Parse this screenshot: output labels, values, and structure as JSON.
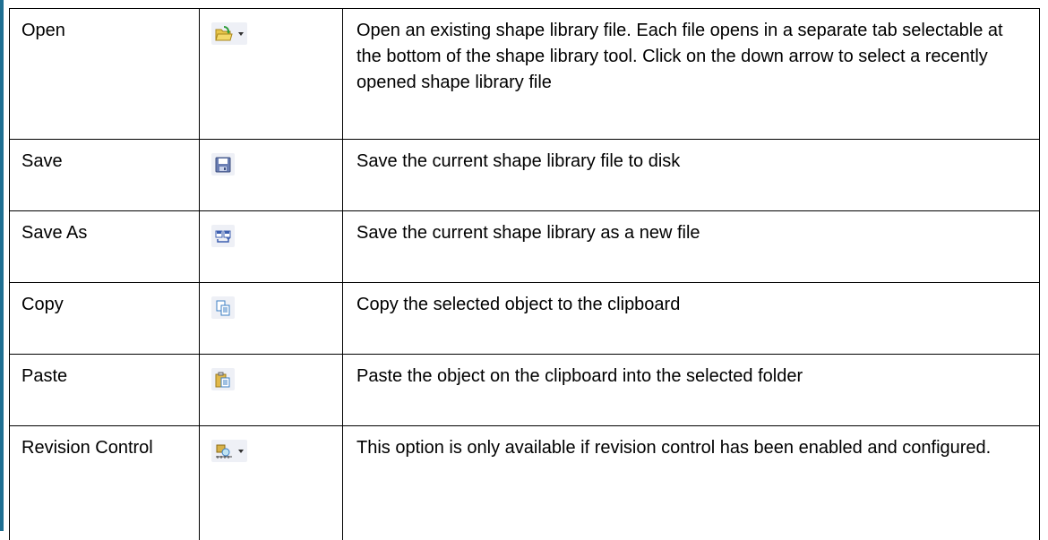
{
  "colors": {
    "left_bar": "#1f6f92",
    "border": "#000000",
    "icon_background": "#eef0f6"
  },
  "rows": [
    {
      "name": "Open",
      "icon": "open-folder-icon",
      "has_dropdown": true,
      "description": "Open an existing shape library file. Each file opens in a separate tab selectable at the bottom of the shape library tool. Click on the down arrow to select a recently opened shape library file"
    },
    {
      "name": "Save",
      "icon": "save-disk-icon",
      "has_dropdown": false,
      "description": "Save the current shape library file to disk"
    },
    {
      "name": "Save As",
      "icon": "save-as-icon",
      "has_dropdown": false,
      "description": "Save the current shape library as a new file"
    },
    {
      "name": "Copy",
      "icon": "copy-icon",
      "has_dropdown": false,
      "description": "Copy the selected object to the clipboard"
    },
    {
      "name": "Paste",
      "icon": "paste-icon",
      "has_dropdown": false,
      "description": "Paste the object on the clipboard into the selected folder"
    },
    {
      "name": "Revision Control",
      "icon": "revision-control-icon",
      "has_dropdown": true,
      "description": "This option is only available if revision control has been enabled and configured."
    }
  ]
}
